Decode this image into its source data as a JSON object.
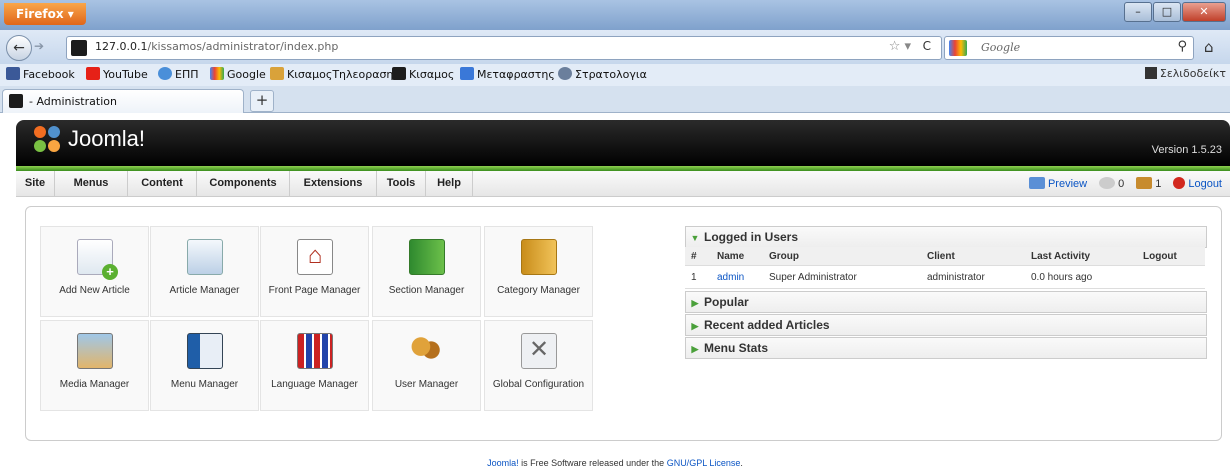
{
  "browser": {
    "app_button": "Firefox",
    "url_host": "127.0.0.1",
    "url_path": "/kissamos/administrator/index.php",
    "search_placeholder": "Google",
    "bookmarks": [
      "Facebook",
      "YouTube",
      "ΕΠΠ",
      "Google",
      "ΚισαμοςΤηλεοραση",
      "Κισαμος",
      "Μεταφραστης",
      "Στρατολογια"
    ],
    "bookmarks_right": "Σελιδοδείκτ",
    "tab_title": "- Administration",
    "new_tab": "+"
  },
  "joomla": {
    "logo_text": "Joomla!",
    "version": "Version 1.5.23",
    "menu": [
      "Site",
      "Menus",
      "Content",
      "Components",
      "Extensions",
      "Tools",
      "Help"
    ],
    "preview": "Preview",
    "messages_count": "0",
    "users_count": "1",
    "logout": "Logout",
    "icons": [
      "Add New Article",
      "Article Manager",
      "Front Page Manager",
      "Section Manager",
      "Category Manager",
      "Media Manager",
      "Menu Manager",
      "Language Manager",
      "User Manager",
      "Global Configuration"
    ],
    "logged_in": {
      "title": "Logged in Users",
      "headers": [
        "#",
        "Name",
        "Group",
        "Client",
        "Last Activity",
        "Logout"
      ],
      "rows": [
        [
          "1",
          "admin",
          "Super Administrator",
          "administrator",
          "0.0 hours ago",
          ""
        ]
      ]
    },
    "sections": [
      "Popular",
      "Recent added Articles",
      "Menu Stats"
    ],
    "footer_prefix": "Joomla!",
    "footer_mid": " is Free Software released under the ",
    "footer_link": "GNU/GPL License",
    "footer_end": "."
  }
}
